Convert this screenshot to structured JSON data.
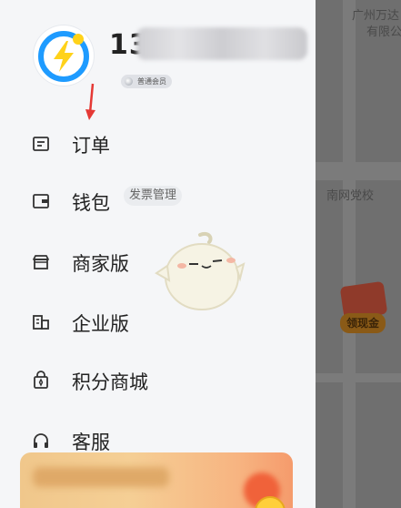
{
  "map": {
    "labels": [
      "广州万达",
      "有限公司",
      "南网党校"
    ],
    "reward_button": "领现金"
  },
  "profile": {
    "username_visible": "13",
    "member_badge": "普通会员"
  },
  "menu": [
    {
      "label": "订单",
      "icon": "order-list-icon"
    },
    {
      "label": "钱包",
      "icon": "wallet-icon",
      "tag": "发票管理"
    },
    {
      "label": "商家版",
      "icon": "storefront-icon"
    },
    {
      "label": "企业版",
      "icon": "building-icon"
    },
    {
      "label": "积分商城",
      "icon": "points-mall-icon"
    },
    {
      "label": "客服",
      "icon": "headset-icon"
    }
  ],
  "colors": {
    "brand_blue": "#1e9bff",
    "accent_yellow": "#ffd21a",
    "annotation_red": "#e53935"
  }
}
